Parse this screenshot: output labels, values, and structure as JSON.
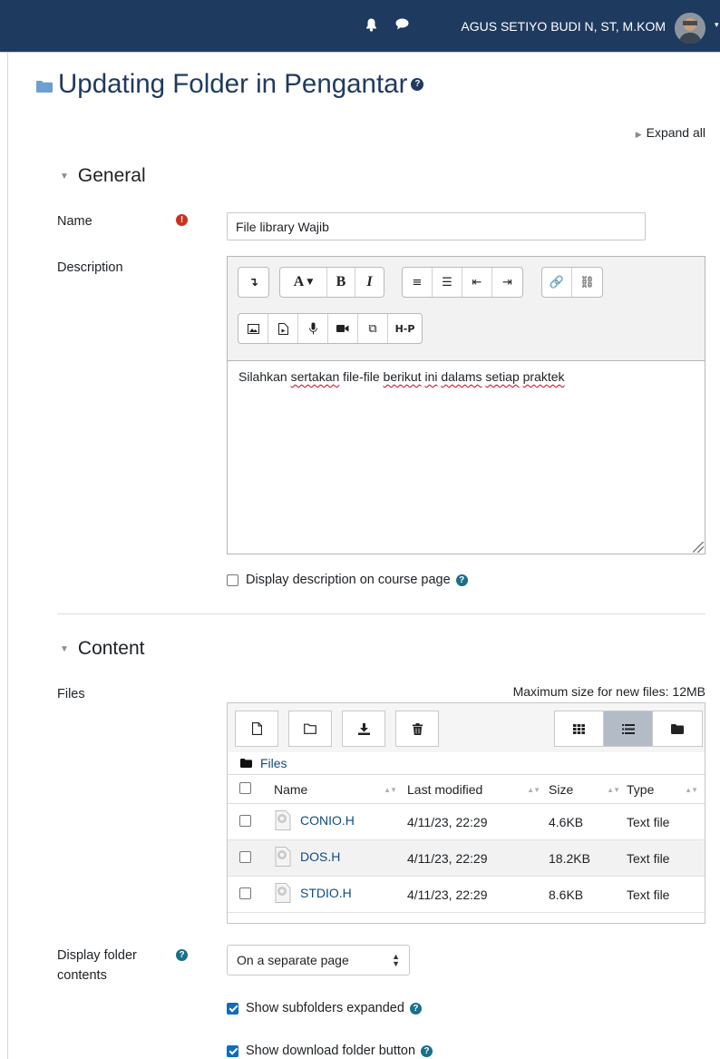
{
  "header": {
    "user_name": "AGUS SETIYO BUDI N, ST, M.KOM",
    "icons": [
      "bell-icon",
      "chat-icon",
      "avatar"
    ]
  },
  "page": {
    "title": "Updating Folder in Pengantar",
    "expand_all": "Expand all"
  },
  "general": {
    "heading": "General",
    "name_label": "Name",
    "name_value": "File library Wajib",
    "description_label": "Description",
    "description_text": {
      "p1": "Silahkan ",
      "p2": "sertakan",
      "p3": " file-file ",
      "p4": "berikut",
      "p5": " ",
      "p6": "ini",
      "p7": " ",
      "p8": "dalams",
      "p9": " ",
      "p10": "setiap",
      "p11": " ",
      "p12": "praktek"
    },
    "display_description": "Display description on course page"
  },
  "content": {
    "heading": "Content",
    "files_label": "Files",
    "max_size": "Maximum size for new files: 12MB",
    "path_root": "Files",
    "columns": {
      "name": "Name",
      "modified": "Last modified",
      "size": "Size",
      "type": "Type"
    },
    "files": [
      {
        "name": "CONIO.H",
        "modified": "4/11/23, 22:29",
        "size": "4.6KB",
        "type": "Text file"
      },
      {
        "name": "DOS.H",
        "modified": "4/11/23, 22:29",
        "size": "18.2KB",
        "type": "Text file"
      },
      {
        "name": "STDIO.H",
        "modified": "4/11/23, 22:29",
        "size": "8.6KB",
        "type": "Text file"
      }
    ],
    "display_folder_label_1": "Display folder",
    "display_folder_label_2": "contents",
    "display_folder_value": "On a separate page",
    "show_subfolders": "Show subfolders expanded",
    "show_download": "Show download folder button"
  },
  "colors": {
    "navbar": "#1f3a5f",
    "link": "#0f4c81",
    "required": "#ca3120",
    "checkbox": "#0f6cbf"
  }
}
